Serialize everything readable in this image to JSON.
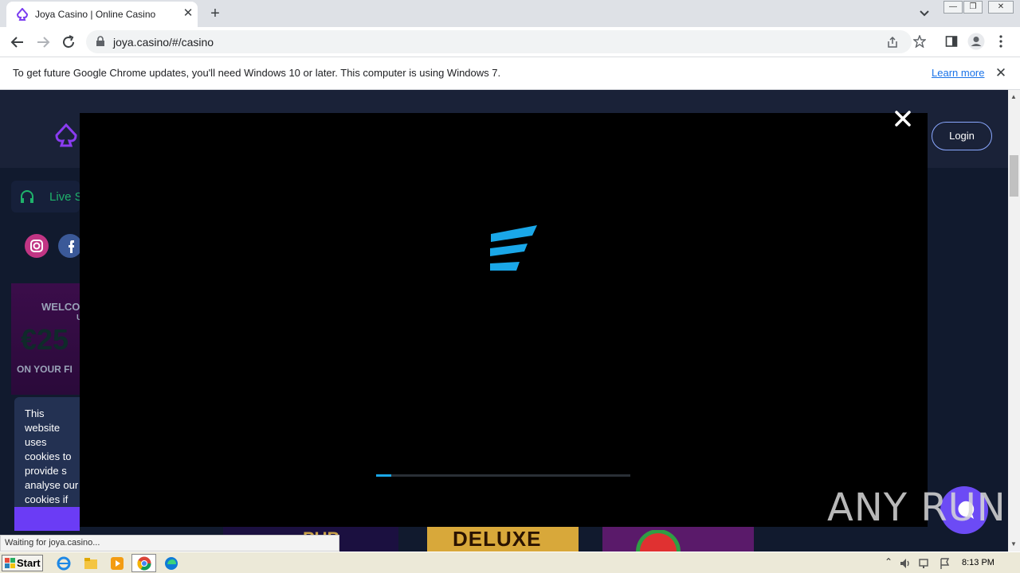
{
  "browser": {
    "tab_title": "Joya Casino | Online Casino",
    "url": "joya.casino/#/casino",
    "window_controls": {
      "minimize": "—",
      "restore": "❐",
      "close": "✕"
    }
  },
  "infobar": {
    "message": "To get future Google Chrome updates, you'll need Windows 10 or later. This computer is using Windows 7.",
    "learn_more": "Learn more"
  },
  "site": {
    "login_label": "Login",
    "live_support_label": "Live S",
    "promo_lines": [
      "WELCO",
      "U",
      "€25",
      "ON YOUR FI"
    ],
    "cookie_text": "This website uses cookies to provide s analyse our cookies if yo website. Co",
    "thumb_deluxe": "DELUXE",
    "thumb_pub": "PUB"
  },
  "player": {
    "progress_fraction": 0.06
  },
  "status_bubble": "Waiting for joya.casino...",
  "taskbar": {
    "start_label": "Start",
    "clock": "8:13 PM"
  },
  "watermark": "ANY RUN",
  "colors": {
    "accent": "#6c4bf5",
    "player_logo": "#1aa7e8",
    "live_green": "#1fb26b"
  }
}
